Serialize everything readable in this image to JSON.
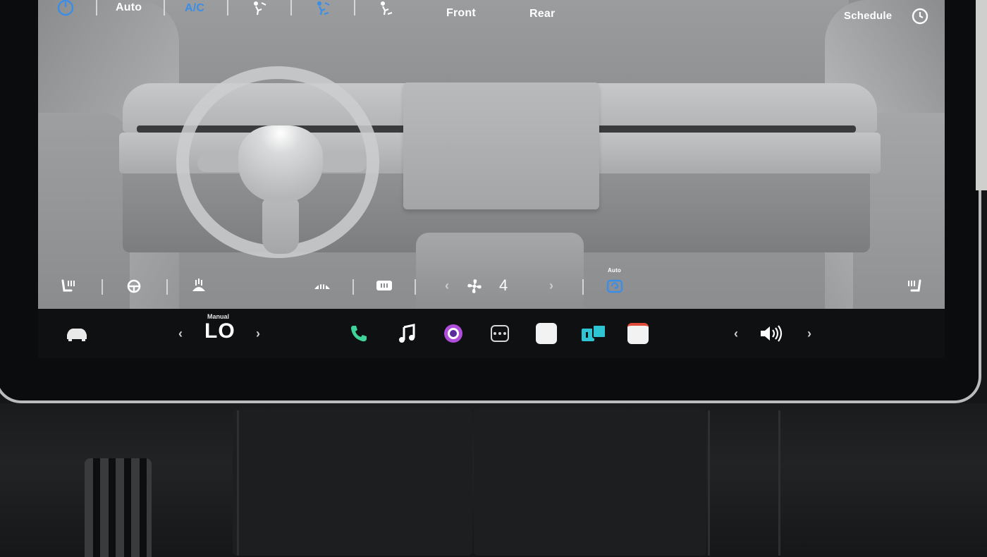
{
  "climate": {
    "top_bar": {
      "power_icon": "power-icon",
      "auto_label": "Auto",
      "ac_label": "A/C",
      "airflow_icons": [
        "airflow-face-icon",
        "airflow-face-feet-icon",
        "airflow-feet-icon"
      ],
      "front_label": "Front",
      "rear_label": "Rear",
      "schedule_label": "Schedule",
      "schedule_icon": "clock-icon"
    },
    "bottom_bar": {
      "left_seat_heater_icon": "seat-heater-icon",
      "steering_heater_icon": "steering-wheel-heater-icon",
      "wiper_defrost_icon": "wiper-defrost-icon",
      "front_defrost_icon": "front-defrost-icon",
      "rear_defrost_icon": "rear-defrost-icon",
      "fan_icon": "fan-icon",
      "fan_speed": "4",
      "recirc_label": "Auto",
      "recirc_icon": "recirculation-icon",
      "right_seat_heater_icon": "seat-heater-icon"
    }
  },
  "taskbar": {
    "car_icon": "car-icon",
    "temp_mode": "Manual",
    "temp_value": "LO",
    "apps": [
      {
        "name": "phone",
        "icon": "phone-icon",
        "color": "#3fd39a"
      },
      {
        "name": "music",
        "icon": "music-note-icon",
        "color": "#ffffff"
      },
      {
        "name": "voice",
        "icon": "voice-orb-icon",
        "color": "#b04ddb"
      },
      {
        "name": "more",
        "icon": "dots-icon",
        "color": "#d6d6d6"
      },
      {
        "name": "notes",
        "icon": "notes-icon",
        "color": "#f2f2f2"
      },
      {
        "name": "toybox",
        "icon": "toybox-icon",
        "color": "#2ec4d3"
      },
      {
        "name": "calendar",
        "icon": "calendar-icon",
        "color": "#f2f2f2"
      }
    ],
    "volume_icon": "volume-icon"
  },
  "colors": {
    "accent_blue": "#3a8ee8",
    "taskbar_bg": "#0f1012"
  }
}
